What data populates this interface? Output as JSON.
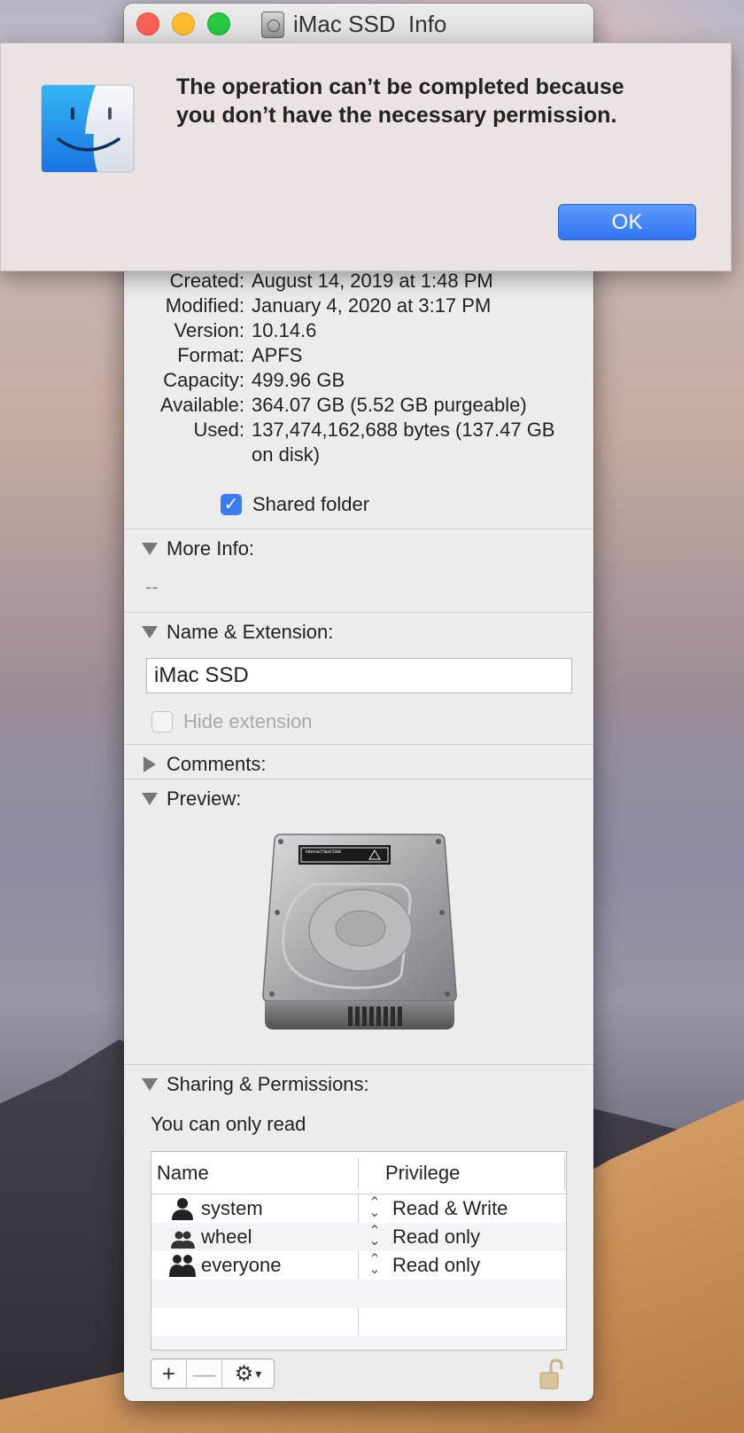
{
  "window": {
    "title": "iMac SSD  Info",
    "icon": "hard-disk-icon"
  },
  "alert": {
    "message_line1": "The operation can’t be completed because",
    "message_line2": "you don’t have the necessary permission.",
    "ok_label": "OK",
    "icon": "finder-icon"
  },
  "general": {
    "rows": [
      {
        "key": "Created:",
        "value": "August 14, 2019 at 1:48 PM"
      },
      {
        "key": "Modified:",
        "value": "January 4, 2020 at 3:17 PM"
      },
      {
        "key": "Version:",
        "value": "10.14.6"
      },
      {
        "key": "Format:",
        "value": "APFS"
      },
      {
        "key": "Capacity:",
        "value": "499.96 GB"
      },
      {
        "key": "Available:",
        "value": "364.07 GB (5.52 GB purgeable)"
      },
      {
        "key": "Used:",
        "value": "137,474,162,688 bytes (137.47 GB on disk)"
      }
    ],
    "shared_folder_label": "Shared folder",
    "shared_folder_checked": true
  },
  "more_info": {
    "label": "More Info:",
    "value": "--"
  },
  "name_extension": {
    "label": "Name & Extension:",
    "name_value": "iMac SSD",
    "hide_extension_label": "Hide extension",
    "hide_extension_checked": false
  },
  "comments": {
    "label": "Comments:"
  },
  "preview": {
    "label": "Preview:",
    "drive_label_text": "Internal Hard Disk"
  },
  "sharing": {
    "label": "Sharing & Permissions:",
    "access_text": "You can only read",
    "columns": {
      "name": "Name",
      "privilege": "Privilege"
    },
    "rows": [
      {
        "name": "system",
        "privilege": "Read & Write",
        "icon": "single-user-icon"
      },
      {
        "name": "wheel",
        "privilege": "Read only",
        "icon": "group-icon"
      },
      {
        "name": "everyone",
        "privilege": "Read only",
        "icon": "everyone-icon"
      }
    ],
    "add_symbol": "+",
    "remove_symbol": "—"
  },
  "colors": {
    "accent": "#3b7cf5",
    "close": "#fc5f57",
    "minimize": "#fdbc2e",
    "zoom": "#28c840"
  }
}
